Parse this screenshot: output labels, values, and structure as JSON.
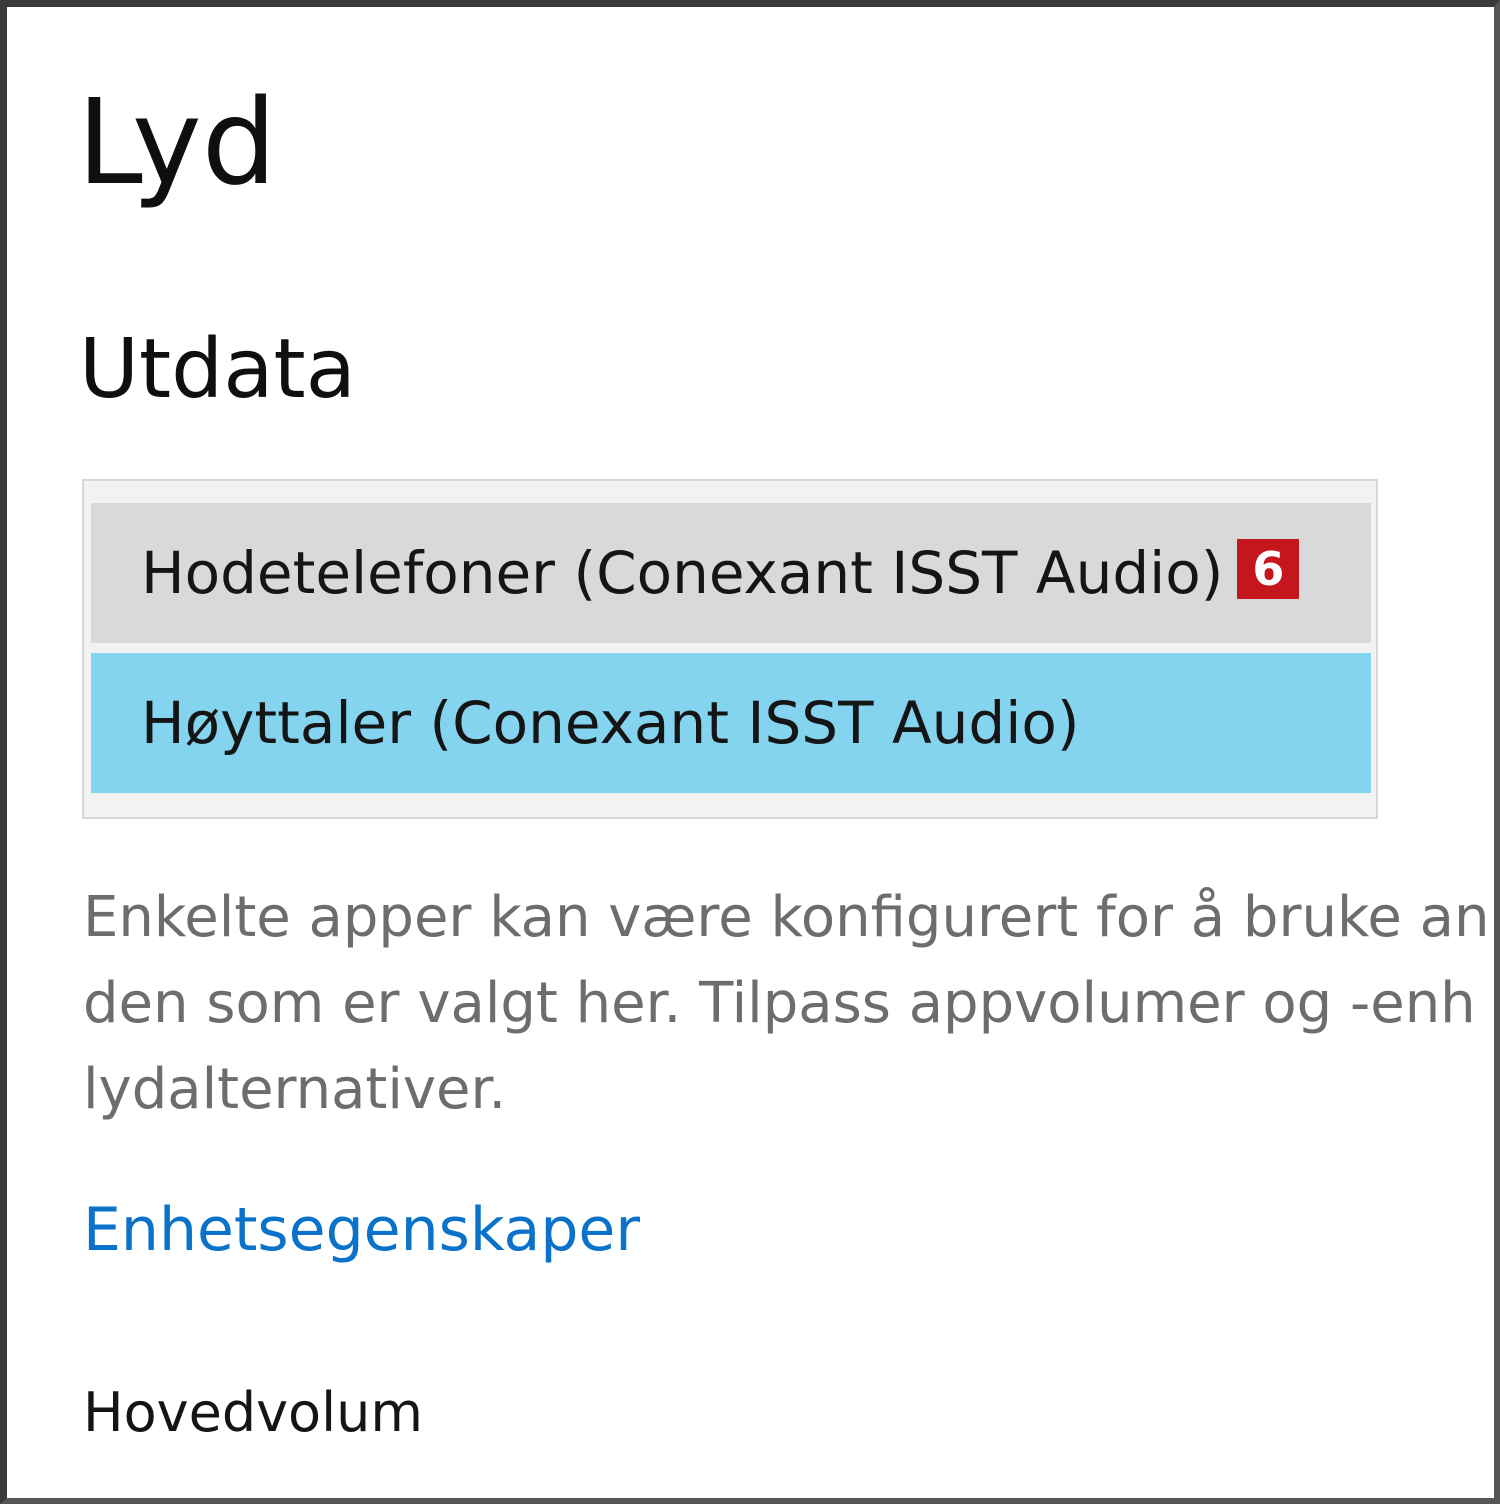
{
  "page": {
    "title": "Lyd"
  },
  "output": {
    "section_title": "Utdata",
    "devices": [
      {
        "label": "Hodetelefoner (Conexant ISST Audio)",
        "badge": "6",
        "selected": false
      },
      {
        "label": "Høyttaler (Conexant ISST Audio)",
        "selected": true
      }
    ],
    "description_lines": [
      "Enkelte apper kan være konfigurert for å bruke an",
      "den som er valgt her. Tilpass appvolumer og -enh",
      "lydalternativer."
    ],
    "device_properties_link": "Enhetsegenskaper",
    "master_volume_label": "Hovedvolum"
  },
  "colors": {
    "hover_item_bg": "#d9d9d9",
    "selected_item_bg": "#84d4f0",
    "link": "#0a72c9",
    "badge_bg": "#c4161d",
    "description_text": "#6d6d6d"
  }
}
